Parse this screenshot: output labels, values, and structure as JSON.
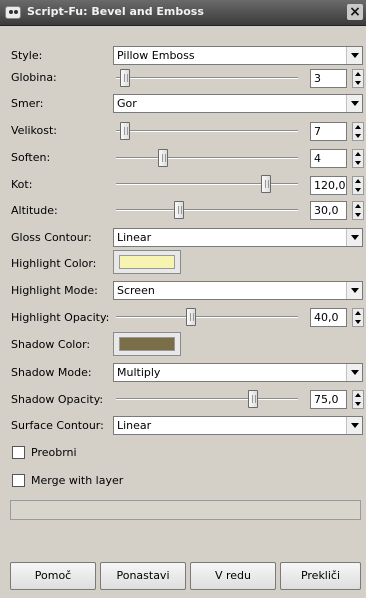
{
  "window": {
    "title": "Script-Fu: Bevel and Emboss",
    "close_glyph": "×"
  },
  "fields": {
    "style": {
      "label": "Style:",
      "value": "Pillow Emboss"
    },
    "globina": {
      "label": "Globina:",
      "value": "3",
      "slider_fraction": 0.0
    },
    "smer": {
      "label": "Smer:",
      "value": "Gor"
    },
    "velikost": {
      "label": "Velikost:",
      "value": "7",
      "slider_fraction": 0.0
    },
    "soften": {
      "label": "Soften:",
      "value": "4",
      "slider_fraction": 0.25
    },
    "kot": {
      "label": "Kot:",
      "value": "120,0",
      "slider_fraction": 0.83
    },
    "altitude": {
      "label": "Altitude:",
      "value": "30,0",
      "slider_fraction": 0.33
    },
    "gloss_contour": {
      "label": "Gloss Contour:",
      "value": "Linear"
    },
    "highlight_color": {
      "label": "Highlight Color:",
      "color": "#f7f3b0"
    },
    "highlight_mode": {
      "label": "Highlight Mode:",
      "value": "Screen"
    },
    "highlight_opacity": {
      "label": "Highlight Opacity:",
      "value": "40,0",
      "slider_fraction": 0.4
    },
    "shadow_color": {
      "label": "Shadow Color:",
      "color": "#7a6e48"
    },
    "shadow_mode": {
      "label": "Shadow Mode:",
      "value": "Multiply"
    },
    "shadow_opacity": {
      "label": "Shadow Opacity:",
      "value": "75,0",
      "slider_fraction": 0.75
    },
    "surface_contour": {
      "label": "Surface Contour:",
      "value": "Linear"
    }
  },
  "checkboxes": {
    "preobrni": {
      "label": "Preobrni",
      "checked": false
    },
    "merge_with_layer": {
      "label": "Merge with layer",
      "checked": false
    }
  },
  "buttons": {
    "help": {
      "label": "Pomoč"
    },
    "reset": {
      "label": "Ponastavi"
    },
    "ok": {
      "label": "V redu"
    },
    "cancel": {
      "label": "Prekliči"
    }
  },
  "icons": {
    "window": "gimp-wilber-icon",
    "close": "close-icon",
    "dropdown": "chevron-down-icon",
    "spinner": "spin-arrows-icon"
  }
}
